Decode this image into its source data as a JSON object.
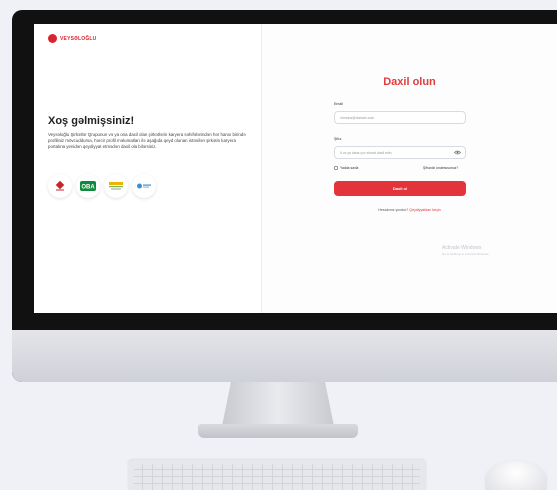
{
  "brand": {
    "name": "VEYSƏLOĞLU",
    "color": "#d8262f"
  },
  "welcome": {
    "title": "Xoş gəlmişsiniz!",
    "description": "Veysəloğlu Şirkətlər Qrupunun və ya ona daxil olan şirkətlərin karyera səhifələrindən hər hansı birində profiliniz mövcuddursa, hərcir profil məlumatları ilə aşağıda qeyd olunan istənilən şirkətin karyera portalına yenidən qeydiyyat etmədən daxil ola bilərsiniz."
  },
  "companies": [
    {
      "name": "veysəloğlu-logo",
      "label": ""
    },
    {
      "name": "oba-logo",
      "label": "OBA"
    },
    {
      "name": "azerbaijan-company-logo",
      "label": ""
    },
    {
      "name": "blue-company-logo",
      "label": ""
    }
  ],
  "login": {
    "title": "Daxil olun",
    "email_label": "Email",
    "email_placeholder": "nümunə@domain.com",
    "password_label": "Şifrə",
    "password_placeholder": "6 və ya daha çox simvol daxil edin",
    "remember_label": "Yadda saxla",
    "forgot_label": "Şifrənizi unutmusunuz?",
    "submit_label": "Daxil ol",
    "register_prompt": "Hesabınız yoxdur?",
    "register_link": "Qeydiyyatdan keçin",
    "accent_color": "#e2343a"
  },
  "watermark": {
    "line1": "Activate Windows",
    "line2": "Go to Settings to activate Windows."
  }
}
